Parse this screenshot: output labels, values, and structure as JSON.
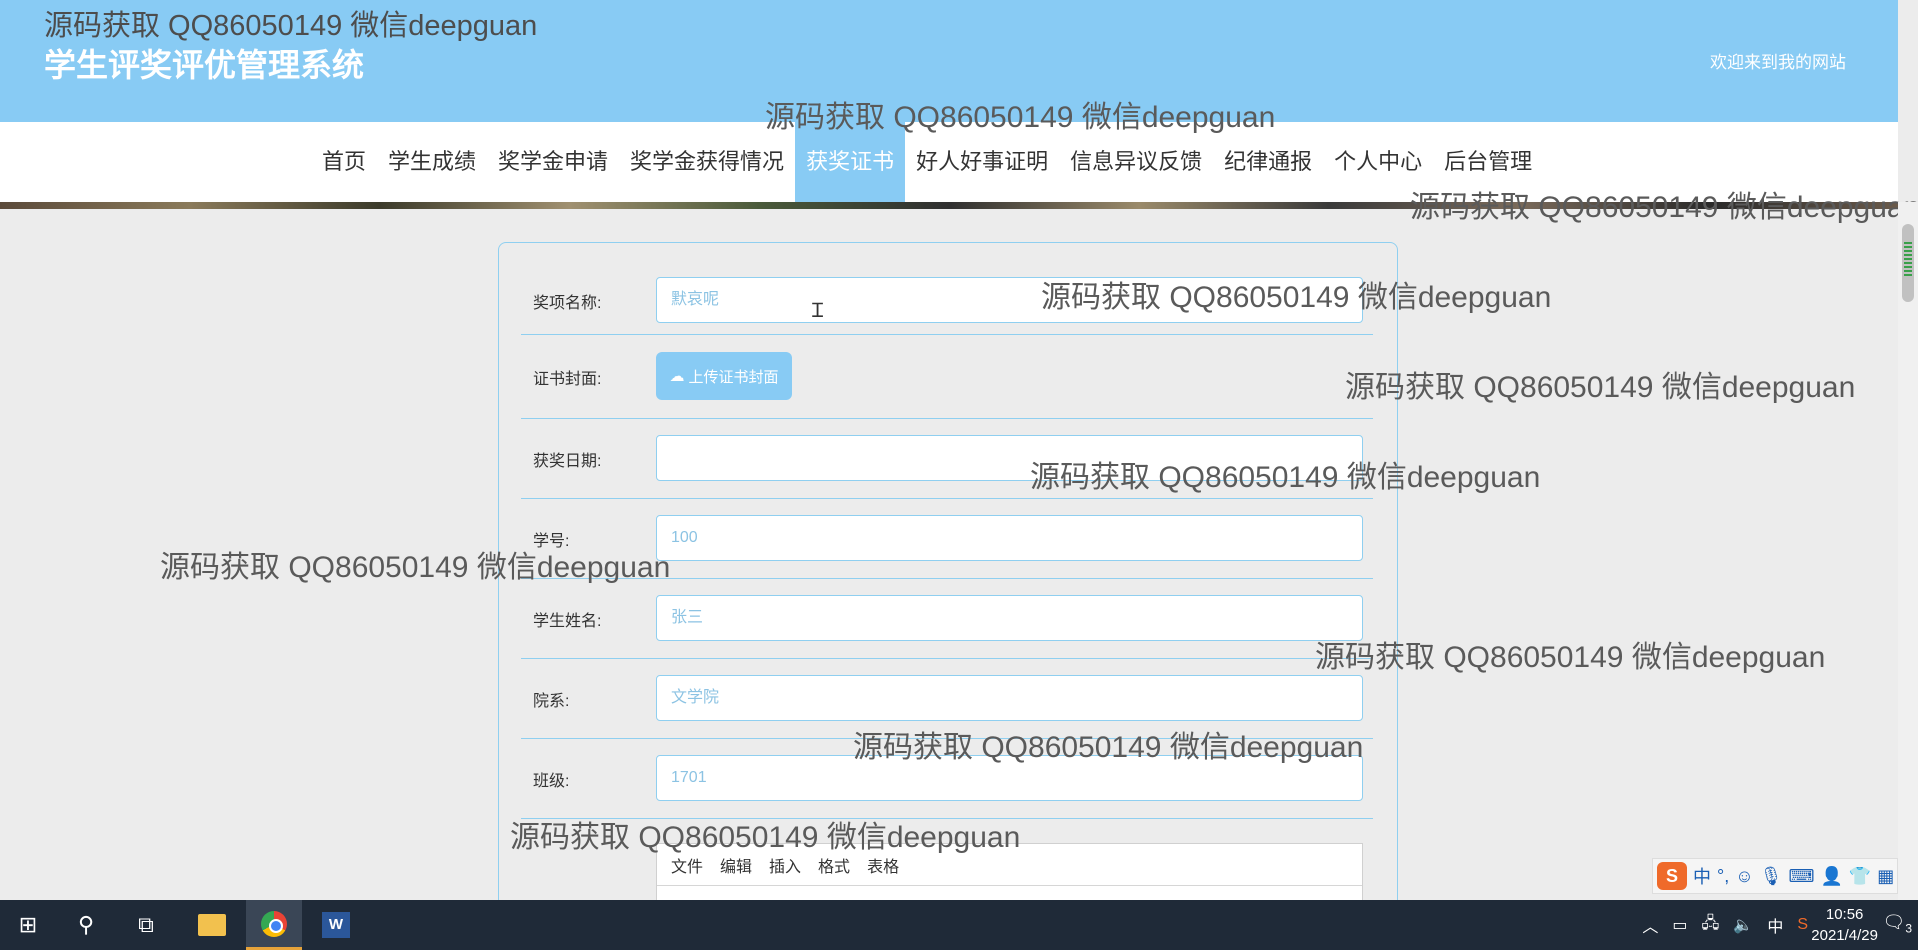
{
  "watermark_text": "源码获取 QQ86050149 微信deepguan",
  "header": {
    "site_title": "学生评奖评优管理系统",
    "welcome": "欢迎来到我的网站"
  },
  "nav": {
    "items": [
      "首页",
      "学生成绩",
      "奖学金申请",
      "奖学金获得情况",
      "获奖证书",
      "好人好事证明",
      "信息异议反馈",
      "纪律通报",
      "个人中心",
      "后台管理"
    ],
    "active": "获奖证书"
  },
  "form": {
    "award_name": {
      "label": "奖项名称:",
      "value": "默哀呢"
    },
    "certificate_cover": {
      "label": "证书封面:",
      "button": "上传证书封面"
    },
    "award_date": {
      "label": "获奖日期:",
      "value": ""
    },
    "student_id": {
      "label": "学号:",
      "value": "100"
    },
    "student_name": {
      "label": "学生姓名:",
      "value": "张三"
    },
    "department": {
      "label": "院系:",
      "value": "文学院"
    },
    "class": {
      "label": "班级:",
      "value": "1701"
    }
  },
  "editor": {
    "menus": [
      "文件",
      "编辑",
      "插入",
      "格式",
      "表格"
    ]
  },
  "ime": {
    "mode": "中",
    "punct": "°,"
  },
  "taskbar": {
    "tray_lang": "中",
    "time": "10:56",
    "date": "2021/4/29",
    "notifications": "3"
  }
}
